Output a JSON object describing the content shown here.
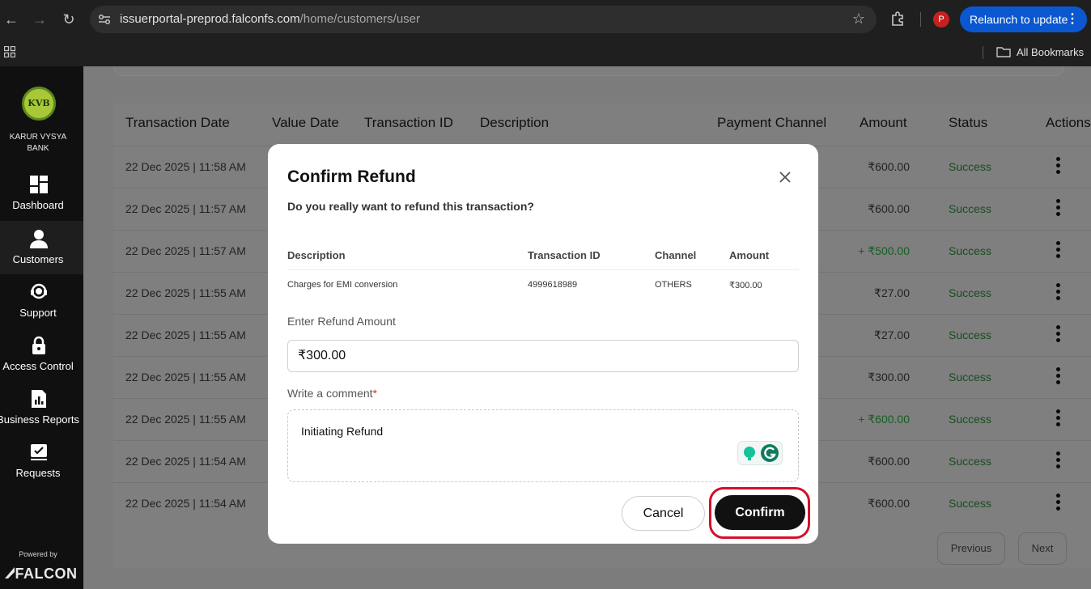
{
  "browser": {
    "url_domain": "issuerportal-preprod.falconfs.com",
    "url_path": "/home/customers/user",
    "relaunch_label": "Relaunch to update",
    "profile_initial": "P",
    "bookmarks_label": "All Bookmarks"
  },
  "sidebar": {
    "logo_text": "KVB",
    "bank_name": "KARUR VYSYA BANK",
    "items": [
      {
        "label": "Dashboard",
        "icon": "dashboard-icon"
      },
      {
        "label": "Customers",
        "icon": "person-icon",
        "active": true
      },
      {
        "label": "Support",
        "icon": "headset-icon"
      },
      {
        "label": "Access Control",
        "icon": "lock-icon"
      },
      {
        "label": "Business Reports",
        "icon": "report-icon"
      },
      {
        "label": "Requests",
        "icon": "request-check-icon"
      }
    ],
    "powered_by": "Powered by",
    "brand": "FALCON"
  },
  "table": {
    "headers": {
      "transaction_date": "Transaction Date",
      "value_date": "Value Date",
      "transaction_id": "Transaction ID",
      "description": "Description",
      "payment_channel": "Payment Channel",
      "amount": "Amount",
      "status": "Status",
      "actions": "Actions"
    },
    "rows": [
      {
        "date": "22 Dec 2025 | 11:58 AM",
        "amount": "₹600.00",
        "status": "Success"
      },
      {
        "date": "22 Dec 2025 | 11:57 AM",
        "amount": "₹600.00",
        "status": "Success"
      },
      {
        "date": "22 Dec 2025 | 11:57 AM",
        "amount": "+ ₹500.00",
        "status": "Success"
      },
      {
        "date": "22 Dec 2025 | 11:55 AM",
        "amount": "₹27.00",
        "status": "Success"
      },
      {
        "date": "22 Dec 2025 | 11:55 AM",
        "amount": "₹27.00",
        "status": "Success"
      },
      {
        "date": "22 Dec 2025 | 11:55 AM",
        "amount": "₹300.00",
        "status": "Success"
      },
      {
        "date": "22 Dec 2025 | 11:55 AM",
        "amount": "+ ₹600.00",
        "status": "Success"
      },
      {
        "date": "22 Dec 2025 | 11:54 AM",
        "amount": "₹600.00",
        "status": "Success"
      },
      {
        "date": "22 Dec 2025 | 11:54 AM",
        "amount": "₹600.00",
        "status": "Success"
      }
    ],
    "pagination": {
      "previous": "Previous",
      "next": "Next"
    }
  },
  "modal": {
    "title": "Confirm Refund",
    "question": "Do you really want to refund this transaction?",
    "headers": {
      "description": "Description",
      "transaction_id": "Transaction ID",
      "channel": "Channel",
      "amount": "Amount"
    },
    "txn": {
      "description": "Charges for EMI conversion",
      "transaction_id": "4999618989",
      "channel": "OTHERS",
      "amount": "₹300.00"
    },
    "refund_label": "Enter Refund Amount",
    "refund_value": "₹300.00",
    "comment_label": "Write a comment",
    "comment_required_mark": "*",
    "comment_value": "Initiating Refund",
    "cancel_label": "Cancel",
    "confirm_label": "Confirm"
  },
  "colors": {
    "success": "#1e7e34",
    "credit": "#1e8a3a",
    "highlight_ring": "#d4102a",
    "relaunch": "#0b57d0"
  }
}
